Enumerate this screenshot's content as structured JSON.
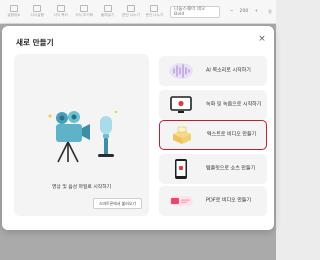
{
  "toolbar": {
    "items": [
      {
        "icon": "undo-icon",
        "label": "실행취소"
      },
      {
        "icon": "redo-icon",
        "label": "다시실행"
      },
      {
        "icon": "copy-icon",
        "label": "서식 복사"
      },
      {
        "icon": "paint-icon",
        "label": "서식 초기화"
      },
      {
        "icon": "paste-icon",
        "label": "붙여넣기"
      },
      {
        "icon": "list-icon",
        "label": "문단 나누기"
      },
      {
        "icon": "merge-icon",
        "label": "문단 나누기"
      }
    ],
    "font": "나눔스퀘어 네오 Bold",
    "size": "200",
    "extra": "용"
  },
  "modal": {
    "title": "새로 만들기",
    "close": "×",
    "big_card": {
      "label": "영상 및 음성 파일로 시작하기",
      "button": "스마트폰에서 불러오기"
    },
    "options": [
      {
        "label": "AI 목소리로 시작하기",
        "icon": "voice-wave-icon"
      },
      {
        "label": "녹화 및 녹음으로 시작하기",
        "icon": "monitor-record-icon"
      },
      {
        "label": "텍스트로 비디오 만들기",
        "icon": "text-to-video-icon"
      },
      {
        "label": "템플릿으로 쇼츠 만들기",
        "icon": "phone-template-icon"
      },
      {
        "label": "PDF로 비디오 만들기",
        "icon": "pdf-icon"
      }
    ]
  },
  "colors": {
    "accent": "#c21f2c",
    "card_bg": "#f4f4f4",
    "illustration_teal": "#4a9fb8"
  }
}
